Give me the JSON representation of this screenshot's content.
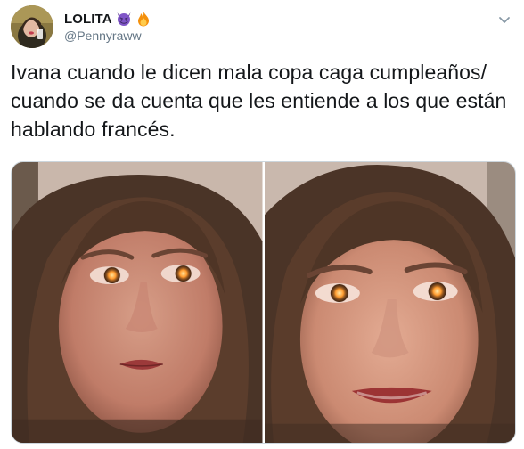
{
  "user": {
    "display_name": "LOLITA",
    "handle": "@Pennyraww",
    "name_emojis": [
      "smiling-devil-emoji",
      "fire-emoji"
    ]
  },
  "tweet": {
    "text": "Ivana cuando le dicen mala copa caga cumpleaños/\ncuando se da cuenta que les entiende a los que están\nhablando francés."
  },
  "media": {
    "photos": [
      {
        "name": "photo-woman-glowing-eyes-serious"
      },
      {
        "name": "photo-woman-glowing-eyes-smiling"
      }
    ]
  },
  "colors": {
    "text_primary": "#14171a",
    "text_secondary": "#657786",
    "border": "#ccd6dd",
    "devil_purple": "#7f55c7",
    "fire_orange": "#f4900c"
  }
}
